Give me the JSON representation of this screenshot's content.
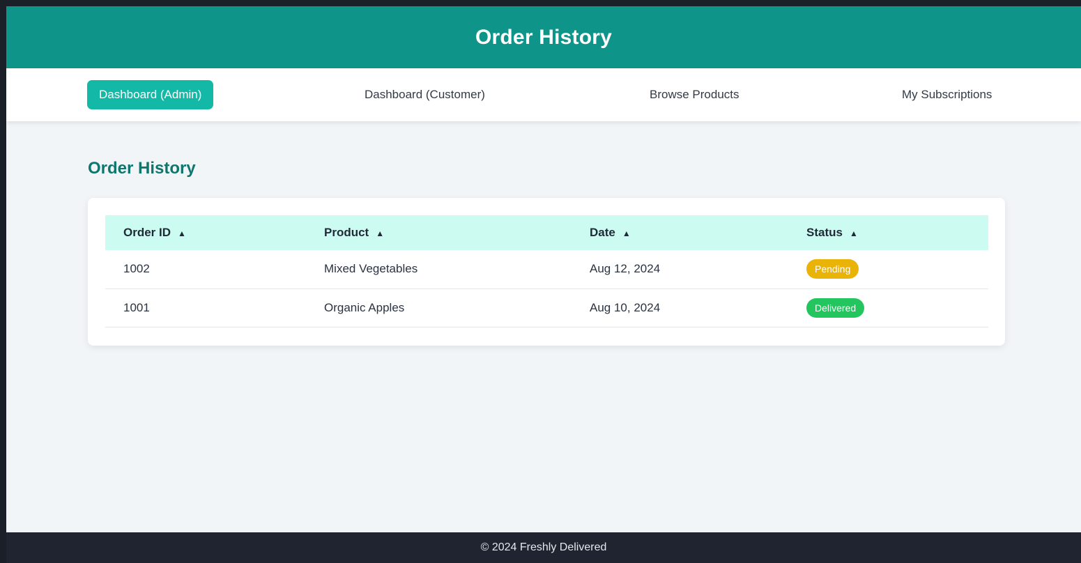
{
  "header": {
    "title": "Order History"
  },
  "nav": {
    "items": [
      {
        "label": "Dashboard (Admin)",
        "active": true
      },
      {
        "label": "Dashboard (Customer)",
        "active": false
      },
      {
        "label": "Browse Products",
        "active": false
      },
      {
        "label": "My Subscriptions",
        "active": false
      }
    ]
  },
  "main": {
    "title": "Order History",
    "table": {
      "columns": [
        {
          "label": "Order ID",
          "sort_icon": "▲"
        },
        {
          "label": "Product",
          "sort_icon": "▲"
        },
        {
          "label": "Date",
          "sort_icon": "▲"
        },
        {
          "label": "Status",
          "sort_icon": "▲"
        }
      ],
      "rows": [
        {
          "order_id": "1002",
          "product": "Mixed Vegetables",
          "date": "Aug 12, 2024",
          "status": "Pending",
          "status_color": "#eab308"
        },
        {
          "order_id": "1001",
          "product": "Organic Apples",
          "date": "Aug 10, 2024",
          "status": "Delivered",
          "status_color": "#22c55e"
        }
      ]
    }
  },
  "footer": {
    "text": "© 2024 Freshly Delivered"
  },
  "colors": {
    "brand": "#0e9488",
    "accent": "#14b8a6",
    "heading": "#0f766e",
    "table_header": "#ccfbf1",
    "footer": "#1f2430"
  }
}
